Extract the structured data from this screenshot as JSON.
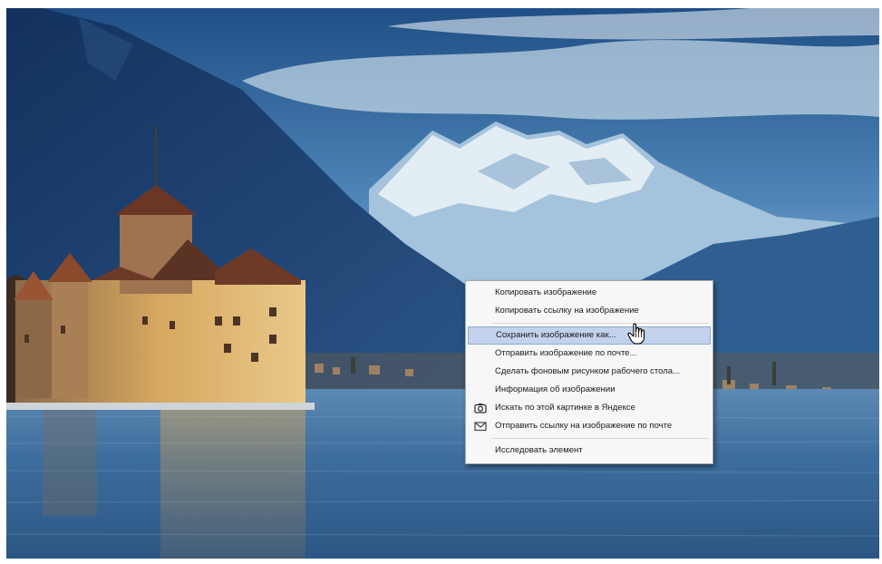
{
  "scene": {
    "description_icon": "lake-castle-mountains-photo",
    "colors": {
      "sky_top": "#2c5a8e",
      "sky_bottom": "#bcd3e4",
      "mountain_dark": "#1f3e6e",
      "snow": "#dde8f1",
      "lake": "#3b6d9c",
      "castle": "#d8a45a"
    }
  },
  "context_menu": {
    "items": [
      {
        "label": "Копировать изображение",
        "icon": null,
        "highlighted": false
      },
      {
        "label": "Копировать ссылку на изображение",
        "icon": null,
        "highlighted": false
      },
      {
        "separator": true
      },
      {
        "label": "Сохранить изображение как...",
        "icon": null,
        "highlighted": true
      },
      {
        "label": "Отправить изображение по почте...",
        "icon": null,
        "highlighted": false
      },
      {
        "label": "Сделать фоновым рисунком рабочего стола...",
        "icon": null,
        "highlighted": false
      },
      {
        "label": "Информация об изображении",
        "icon": null,
        "highlighted": false
      },
      {
        "label": "Искать по этой картинке в Яндексе",
        "icon": "camera-icon",
        "highlighted": false
      },
      {
        "label": "Отправить ссылку на изображение по почте",
        "icon": "envelope-icon",
        "highlighted": false
      },
      {
        "separator": true
      },
      {
        "label": "Исследовать элемент",
        "icon": null,
        "highlighted": false
      }
    ],
    "highlight_color": "#c3d2ec"
  },
  "cursor": {
    "icon": "hand-pointer-icon"
  }
}
